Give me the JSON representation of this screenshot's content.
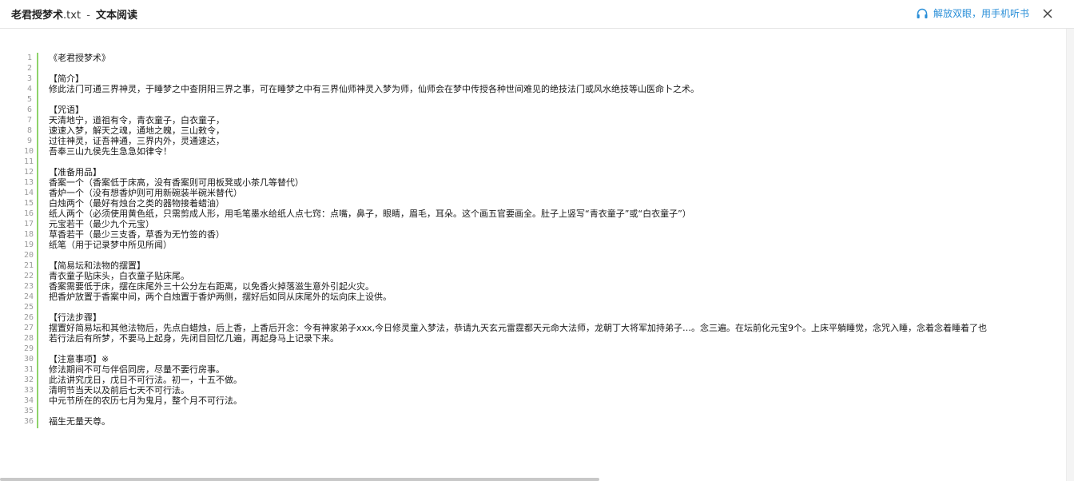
{
  "window": {
    "file_name": "老君授梦术",
    "file_ext": ".txt",
    "separator": "-",
    "app_name": "文本阅读",
    "listen_label": "解放双眼，用手机听书",
    "close_icon": "close-icon",
    "listen_icon": "headphones-icon",
    "accent_color": "#2b8fd8",
    "gutter_color": "#8fd36b"
  },
  "lines": [
    {
      "n": "1",
      "text": "《老君授梦术》"
    },
    {
      "n": "2",
      "text": ""
    },
    {
      "n": "3",
      "text": "【简介】"
    },
    {
      "n": "4",
      "text": "修此法门可通三界神灵，于睡梦之中查阴阳三界之事，可在睡梦之中有三界仙师神灵入梦为师，仙师会在梦中传授各种世间难见的绝技法门或风水绝技等山医命卜之术。"
    },
    {
      "n": "5",
      "text": ""
    },
    {
      "n": "6",
      "text": "【咒语】"
    },
    {
      "n": "7",
      "text": "天清地宁，道祖有令，青衣童子，白衣童子，"
    },
    {
      "n": "8",
      "text": "速速入梦，解天之魂，通地之魄，三山敕令，"
    },
    {
      "n": "9",
      "text": "过往神灵，证吾神通，三界内外，灵通速达，"
    },
    {
      "n": "10",
      "text": "吾奉三山九侯先生急急如律令！"
    },
    {
      "n": "11",
      "text": ""
    },
    {
      "n": "12",
      "text": "【准备用品】"
    },
    {
      "n": "13",
      "text": "香案一个（香案低于床高，没有香案则可用板凳或小茶几等替代）"
    },
    {
      "n": "14",
      "text": "香炉一个（没有想香炉则可用新碗装半碗米替代）"
    },
    {
      "n": "15",
      "text": "白烛两个（最好有烛台之类的器物接着蜡油）"
    },
    {
      "n": "16",
      "text": "纸人两个（必须使用黄色纸，只需剪成人形，用毛笔墨水给纸人点七窍：点嘴，鼻子，眼睛，眉毛，耳朵。这个画五官要画全。肚子上竖写“青衣童子”或“白衣童子”）"
    },
    {
      "n": "17",
      "text": "元宝若干（最少九个元宝）"
    },
    {
      "n": "18",
      "text": "草香若干（最少三支香，草香为无竹签的香）"
    },
    {
      "n": "19",
      "text": "纸笔（用于记录梦中所见所闻）"
    },
    {
      "n": "20",
      "text": ""
    },
    {
      "n": "21",
      "text": "【简易坛和法物的摆置】"
    },
    {
      "n": "22",
      "text": "青衣童子贴床头，白衣童子贴床尾。"
    },
    {
      "n": "23",
      "text": "香案需要低于床，摆在床尾外三十公分左右距离，以免香火掉落滋生意外引起火灾。"
    },
    {
      "n": "24",
      "text": "把香炉放置于香案中间，两个白烛置于香炉两侧，摆好后如同从床尾外的坛向床上设供。"
    },
    {
      "n": "25",
      "text": ""
    },
    {
      "n": "26",
      "text": "【行法步骤】"
    },
    {
      "n": "27",
      "text": "摆置好简易坛和其他法物后，先点白蜡烛，后上香，上香后开念：今有神家弟子xxx,今日修灵童入梦法，恭请九天玄元雷霆都天元命大法师，龙朝丁大将军加持弟子…。念三遍。在坛前化元宝9个。上床平躺睡觉，念咒入睡，念着念着睡着了也"
    },
    {
      "n": "28",
      "text": "若行法后有所梦，不要马上起身，先闭目回忆几遍，再起身马上记录下来。"
    },
    {
      "n": "29",
      "text": ""
    },
    {
      "n": "30",
      "text": "【注意事项】※"
    },
    {
      "n": "31",
      "text": "修法期间不可与伴侣同房，尽量不要行房事。"
    },
    {
      "n": "32",
      "text": "此法讲究戊日，戊日不可行法。初一，十五不做。"
    },
    {
      "n": "33",
      "text": "清明节当天以及前后七天不可行法。"
    },
    {
      "n": "34",
      "text": "中元节所在的农历七月为鬼月，整个月不可行法。"
    },
    {
      "n": "35",
      "text": ""
    },
    {
      "n": "36",
      "text": "福生无量天尊。"
    }
  ]
}
